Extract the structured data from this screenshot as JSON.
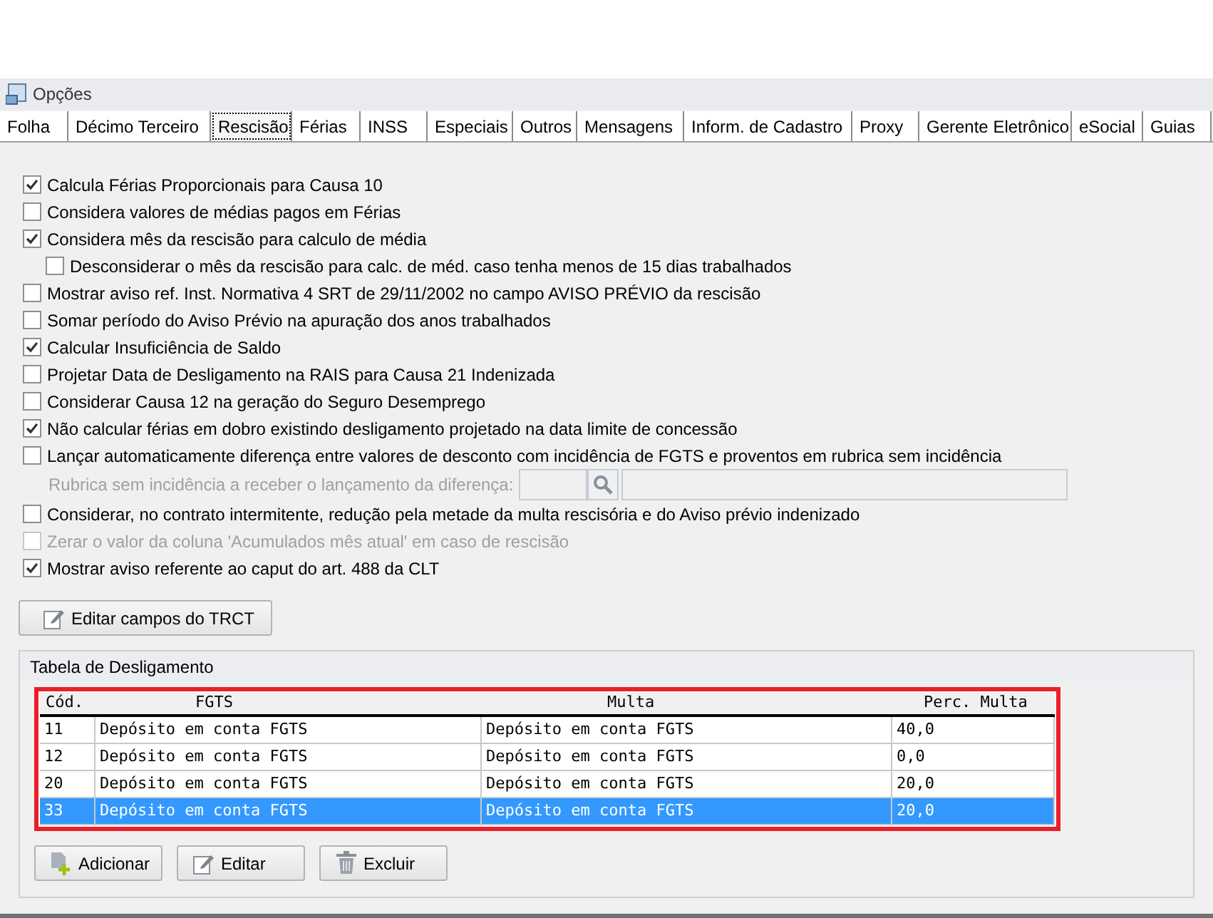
{
  "window": {
    "title": "Opções"
  },
  "tabs": [
    {
      "label": "Folha",
      "selected": false
    },
    {
      "label": "Décimo Terceiro",
      "selected": false
    },
    {
      "label": "Rescisão",
      "selected": true
    },
    {
      "label": "Férias",
      "selected": false
    },
    {
      "label": "INSS",
      "selected": false
    },
    {
      "label": "Especiais",
      "selected": false
    },
    {
      "label": "Outros",
      "selected": false
    },
    {
      "label": "Mensagens",
      "selected": false
    },
    {
      "label": "Inform. de Cadastro",
      "selected": false
    },
    {
      "label": "Proxy",
      "selected": false
    },
    {
      "label": "Gerente Eletrônico",
      "selected": false
    },
    {
      "label": "eSocial",
      "selected": false
    },
    {
      "label": "Guias",
      "selected": false
    }
  ],
  "options": [
    {
      "kind": "checkbox",
      "label": "Calcula Férias Proporcionais para Causa 10",
      "checked": true,
      "disabled": false
    },
    {
      "kind": "checkbox",
      "label": "Considera valores de médias pagos em Férias",
      "checked": false,
      "disabled": false
    },
    {
      "kind": "checkbox",
      "label": "Considera mês da rescisão para calculo de média",
      "checked": true,
      "disabled": false,
      "children": [
        {
          "kind": "checkbox",
          "label": "Desconsiderar o mês da rescisão para calc. de méd. caso tenha menos de 15 dias trabalhados",
          "checked": false,
          "disabled": false
        }
      ]
    },
    {
      "kind": "checkbox",
      "label": "Mostrar aviso ref. Inst. Normativa 4 SRT de 29/11/2002 no campo AVISO PRÉVIO da rescisão",
      "checked": false,
      "disabled": false
    },
    {
      "kind": "checkbox",
      "label": "Somar período do Aviso Prévio na apuração dos anos trabalhados",
      "checked": false,
      "disabled": false
    },
    {
      "kind": "checkbox",
      "label": "Calcular Insuficiência de Saldo",
      "checked": true,
      "disabled": false
    },
    {
      "kind": "checkbox",
      "label": "Projetar Data de Desligamento na RAIS para Causa 21 Indenizada",
      "checked": false,
      "disabled": false
    },
    {
      "kind": "checkbox",
      "label": "Considerar Causa 12 na geração do Seguro Desemprego",
      "checked": false,
      "disabled": false
    },
    {
      "kind": "checkbox",
      "label": "Não calcular férias em dobro existindo desligamento projetado na data limite de concessão",
      "checked": true,
      "disabled": false
    },
    {
      "kind": "checkbox",
      "label": "Lançar automaticamente diferença entre valores de desconto com incidência de FGTS e proventos em rubrica sem incidência",
      "checked": false,
      "disabled": false
    },
    {
      "kind": "lookup",
      "label": "Rubrica sem incidência a receber o lançamento da diferença:",
      "disabled": true
    },
    {
      "kind": "checkbox",
      "label": "Considerar, no contrato intermitente, redução pela metade da multa rescisória e do Aviso prévio indenizado",
      "checked": false,
      "disabled": false
    },
    {
      "kind": "checkbox",
      "label": "Zerar o valor da coluna 'Acumulados mês atual' em caso de rescisão",
      "checked": false,
      "disabled": true
    },
    {
      "kind": "checkbox",
      "label": "Mostrar aviso referente ao caput do art. 488 da CLT",
      "checked": true,
      "disabled": false
    }
  ],
  "edit_trct_button": "Editar campos do TRCT",
  "group": {
    "title": "Tabela de Desligamento",
    "table": {
      "highlighted": true,
      "columns": [
        "Cód.",
        "FGTS",
        "Multa",
        "Perc. Multa"
      ],
      "rows": [
        {
          "cells": [
            "11",
            "Depósito em conta FGTS",
            "Depósito em conta FGTS",
            "40,0"
          ],
          "selected": false
        },
        {
          "cells": [
            "12",
            "Depósito em conta FGTS",
            "Depósito em conta FGTS",
            "0,0"
          ],
          "selected": false
        },
        {
          "cells": [
            "20",
            "Depósito em conta FGTS",
            "Depósito em conta FGTS",
            "20,0"
          ],
          "selected": false
        },
        {
          "cells": [
            "33",
            "Depósito em conta FGTS",
            "Depósito em conta FGTS",
            "20,0"
          ],
          "selected": true
        }
      ]
    },
    "buttons": [
      {
        "kind": "add",
        "label": "Adicionar"
      },
      {
        "kind": "edit",
        "label": "Editar"
      },
      {
        "kind": "delete",
        "label": "Excluir"
      }
    ]
  }
}
